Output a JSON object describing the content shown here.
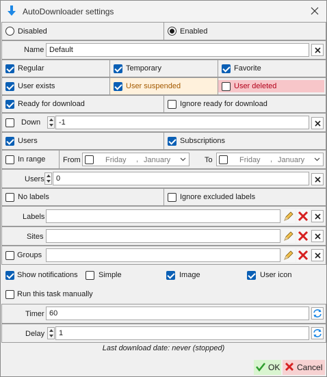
{
  "window": {
    "title": "AutoDownloader settings"
  },
  "mode": {
    "disabled_label": "Disabled",
    "enabled_label": "Enabled",
    "selected": "enabled"
  },
  "name": {
    "label": "Name",
    "value": "Default"
  },
  "types": [
    {
      "label": "Regular",
      "checked": true
    },
    {
      "label": "Temporary",
      "checked": true
    },
    {
      "label": "Favorite",
      "checked": true
    }
  ],
  "user_state": [
    {
      "label": "User exists",
      "checked": true
    },
    {
      "label": "User suspended",
      "checked": true
    },
    {
      "label": "User deleted",
      "checked": false
    }
  ],
  "ready": {
    "ready_label": "Ready for download",
    "ready_checked": true,
    "ignore_label": "Ignore ready for download",
    "ignore_checked": false
  },
  "down": {
    "label": "Down",
    "checked": false,
    "value": "-1"
  },
  "target": {
    "users_label": "Users",
    "users_checked": true,
    "subs_label": "Subscriptions",
    "subs_checked": true
  },
  "range": {
    "label": "In range",
    "checked": false,
    "from_label": "From",
    "from_day": "Friday",
    "from_month": "January",
    "to_label": "To",
    "to_day": "Friday",
    "to_month": "January"
  },
  "users_count": {
    "label": "Users",
    "value": "0"
  },
  "labels_opts": {
    "no_labels": "No labels",
    "no_labels_checked": false,
    "ignore_excluded": "Ignore excluded labels",
    "ignore_excluded_checked": false
  },
  "labels": {
    "label": "Labels",
    "value": ""
  },
  "sites": {
    "label": "Sites",
    "value": ""
  },
  "groups": {
    "label": "Groups",
    "checked": false,
    "value": ""
  },
  "notifications": [
    {
      "label": "Show notifications",
      "checked": true
    },
    {
      "label": "Simple",
      "checked": false
    },
    {
      "label": "Image",
      "checked": true
    },
    {
      "label": "User icon",
      "checked": true
    }
  ],
  "manual": {
    "label": "Run this task manually",
    "checked": false
  },
  "timer": {
    "label": "Timer",
    "value": "60"
  },
  "delay": {
    "label": "Delay",
    "value": "1"
  },
  "status": "Last download date: never (stopped)",
  "buttons": {
    "ok": "OK",
    "cancel": "Cancel"
  },
  "colors": {
    "accent": "#0a5fb5",
    "suspended_bg": "#fff1dc",
    "suspended_text": "#a35a00",
    "deleted_bg": "#f7c6c9",
    "deleted_text": "#b3001b"
  }
}
